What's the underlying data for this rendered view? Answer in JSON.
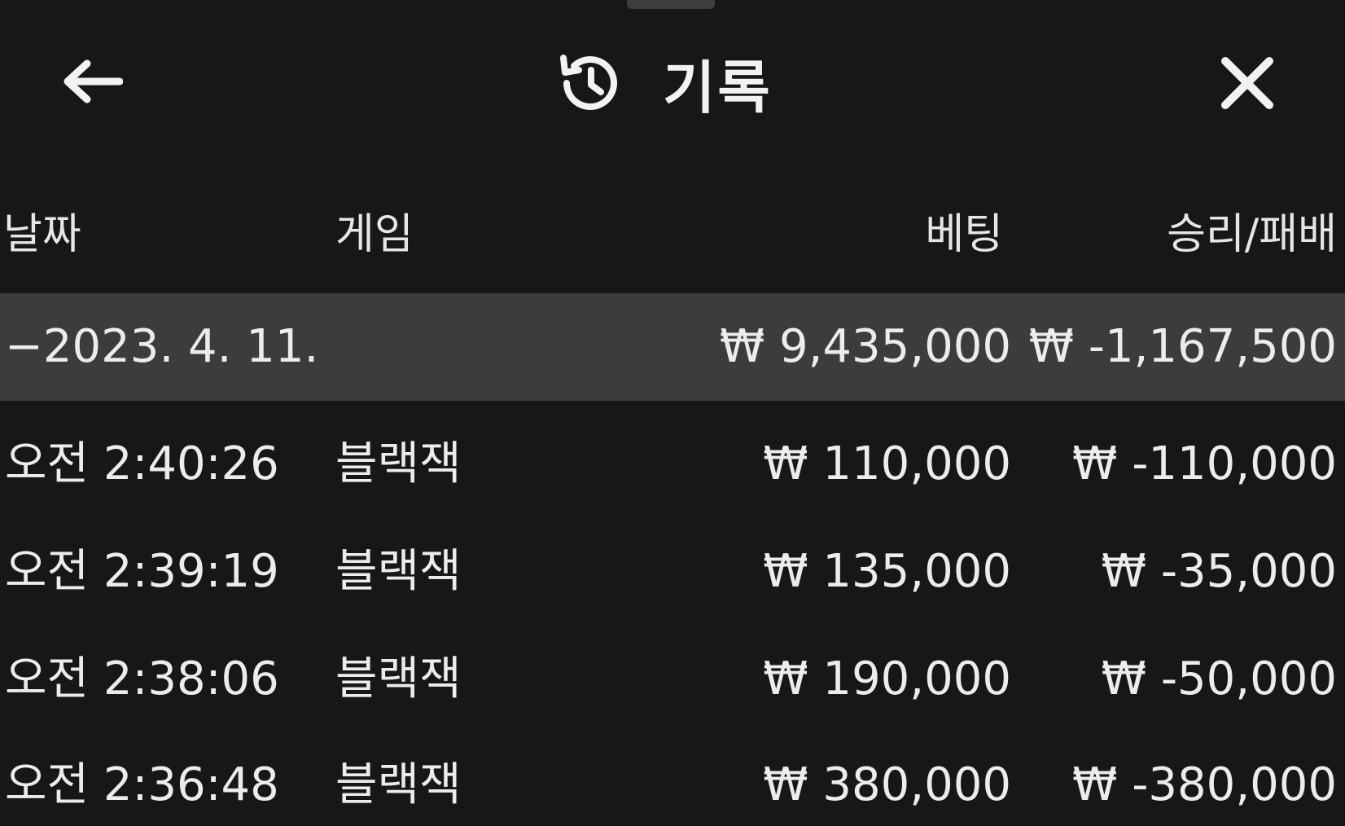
{
  "header": {
    "title": "기록",
    "back_icon": "arrow-left-icon",
    "history_icon": "history-icon",
    "close_icon": "close-icon"
  },
  "columns": {
    "date": "날짜",
    "game": "게임",
    "bet": "베팅",
    "result": "승리/패배"
  },
  "summary": {
    "date": "−2023. 4. 11.",
    "bet": "₩ 9,435,000",
    "result": "₩ -1,167,500"
  },
  "rows": [
    {
      "time": "오전 2:40:26",
      "game": "블랙잭",
      "bet": "₩ 110,000",
      "result": "₩ -110,000"
    },
    {
      "time": "오전 2:39:19",
      "game": "블랙잭",
      "bet": "₩ 135,000",
      "result": "₩ -35,000"
    },
    {
      "time": "오전 2:38:06",
      "game": "블랙잭",
      "bet": "₩ 190,000",
      "result": "₩ -50,000"
    },
    {
      "time": "오전 2:36:48",
      "game": "블랙잭",
      "bet": "₩ 380,000",
      "result": "₩ -380,000"
    }
  ],
  "colors": {
    "background": "#171718",
    "summary_row": "#3c3c3e",
    "text": "#ececec"
  }
}
